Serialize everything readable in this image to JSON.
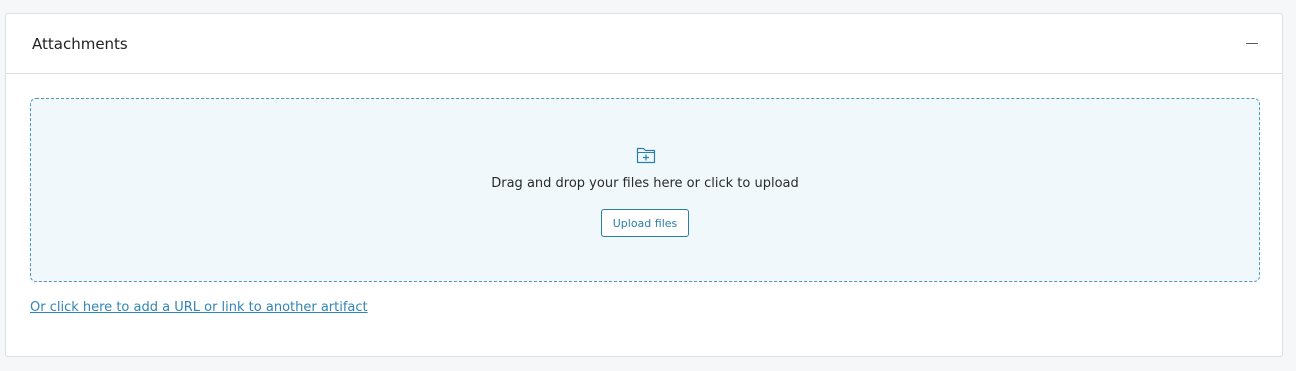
{
  "panel": {
    "title": "Attachments",
    "collapse_icon": "minus-icon"
  },
  "dropzone": {
    "icon": "folder-plus-icon",
    "instruction": "Drag and drop your files here or click to upload",
    "upload_label": "Upload files"
  },
  "link": {
    "text": "Or click here to add a URL or link to another artifact"
  },
  "colors": {
    "accent": "#2a7fa8",
    "dropzone_bg": "#f1f8fb",
    "dropzone_border": "#4a98c0",
    "link": "#2f85b5"
  }
}
